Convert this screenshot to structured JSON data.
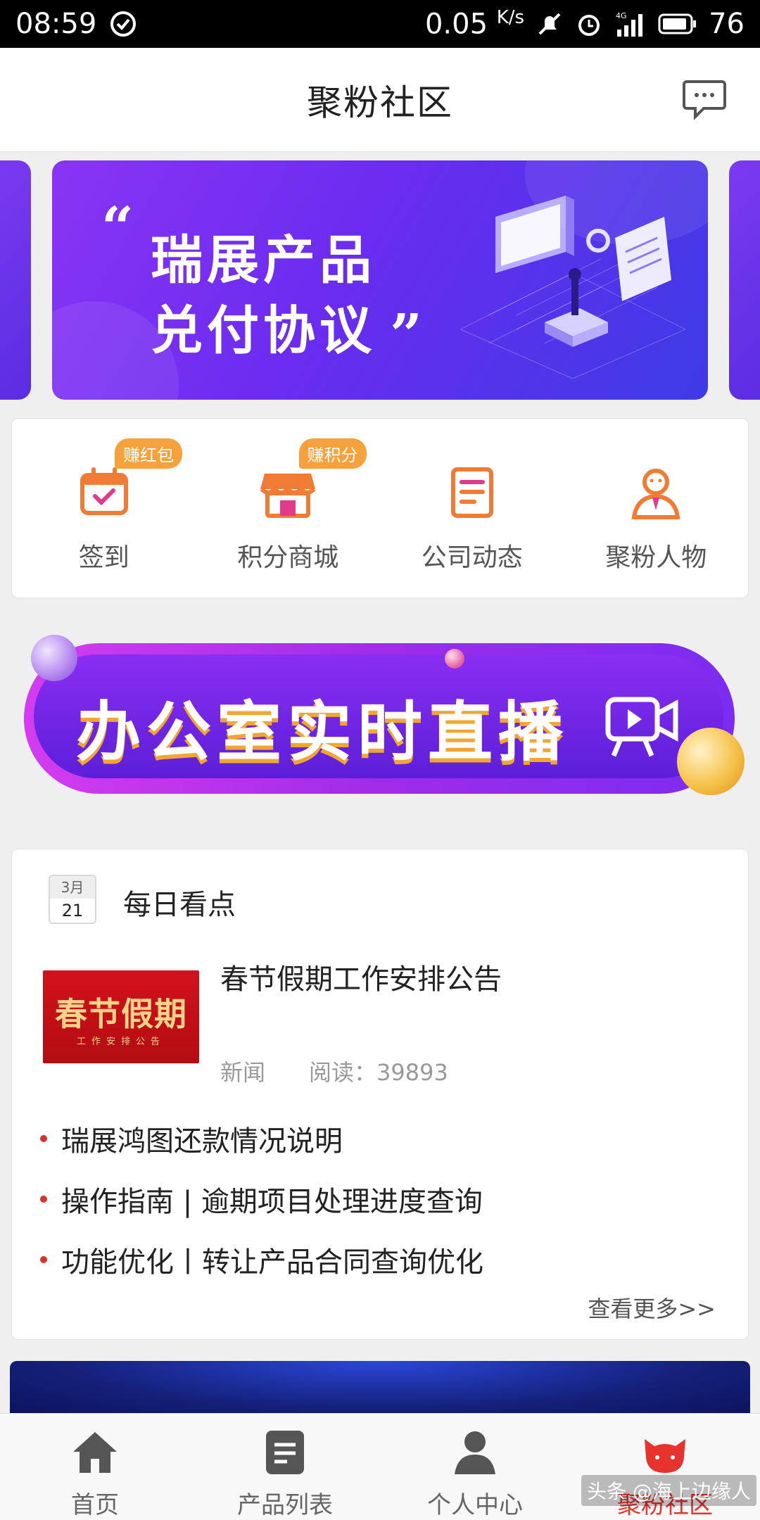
{
  "status_bar": {
    "time": "08:59",
    "speed": "0.05",
    "speed_unit": "K/s",
    "network": "4G",
    "battery": "76"
  },
  "header": {
    "title": "聚粉社区",
    "message_icon": "chat-bubble-icon"
  },
  "banner": {
    "line1": "瑞展产品",
    "line2": "兑付协议"
  },
  "quick_menu": [
    {
      "label": "签到",
      "tag": "赚红包",
      "icon": "calendar-check-icon"
    },
    {
      "label": "积分商城",
      "tag": "赚积分",
      "icon": "store-icon"
    },
    {
      "label": "公司动态",
      "tag": "",
      "icon": "document-icon"
    },
    {
      "label": "聚粉人物",
      "tag": "",
      "icon": "person-icon"
    }
  ],
  "live_banner": {
    "text": "办公室实时直播",
    "icon": "video-camera-icon"
  },
  "daily": {
    "calendar_month": "3月",
    "calendar_day": "21",
    "title": "每日看点",
    "featured": {
      "thumb_title": "春节假期",
      "thumb_subtitle": "工作安排公告",
      "title": "春节假期工作安排公告",
      "category": "新闻",
      "reads": "阅读：39893"
    },
    "items": [
      "瑞展鸿图还款情况说明",
      "操作指南 | 逾期项目处理进度查询",
      "功能优化丨转让产品合同查询优化"
    ],
    "more": "查看更多>>"
  },
  "tabbar": [
    {
      "label": "首页",
      "icon": "home-icon",
      "active": false
    },
    {
      "label": "产品列表",
      "icon": "list-icon",
      "active": false
    },
    {
      "label": "个人中心",
      "icon": "user-icon",
      "active": false
    },
    {
      "label": "聚粉社区",
      "icon": "cat-icon",
      "active": true
    }
  ],
  "watermark": "头条 @海上边缘人",
  "colors": {
    "accent_red": "#e8322e",
    "orange": "#f07b34",
    "purple": "#6a2cf0",
    "tag_orange": "#f6a13c"
  }
}
